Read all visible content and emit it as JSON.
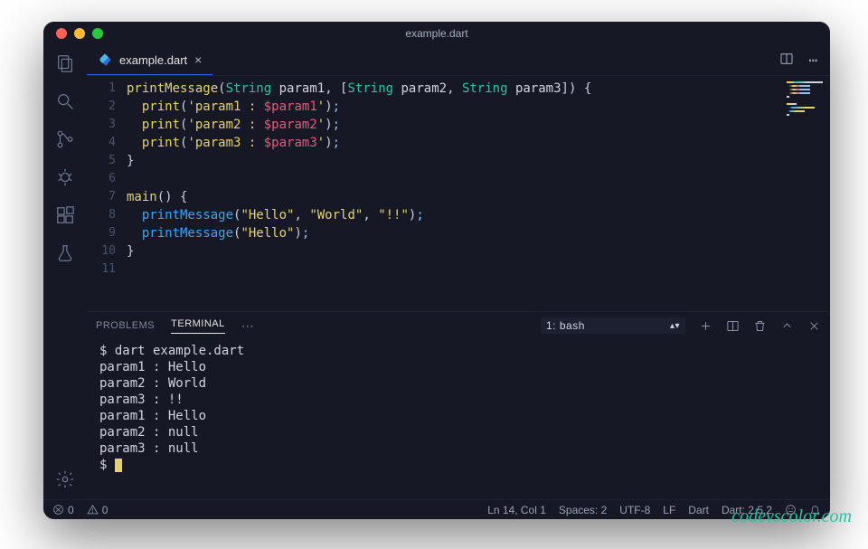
{
  "window": {
    "title": "example.dart"
  },
  "tab": {
    "label": "example.dart"
  },
  "code": {
    "lines": [
      {
        "n": "1",
        "tokens": [
          [
            "fn",
            "printMessage"
          ],
          [
            "paren",
            "("
          ],
          [
            "type",
            "String"
          ],
          [
            "param",
            " param1"
          ],
          [
            "paren",
            ", ["
          ],
          [
            "type",
            "String"
          ],
          [
            "param",
            " param2"
          ],
          [
            "paren",
            ", "
          ],
          [
            "type",
            "String"
          ],
          [
            "param",
            " param3"
          ],
          [
            "paren",
            "]) "
          ],
          [
            "brace",
            "{"
          ]
        ]
      },
      {
        "n": "2",
        "tokens": [
          [
            "plain",
            "  "
          ],
          [
            "fn",
            "print"
          ],
          [
            "paren",
            "("
          ],
          [
            "str",
            "'param1 : "
          ],
          [
            "interp",
            "$param1"
          ],
          [
            "str",
            "'"
          ],
          [
            "paren",
            ")"
          ],
          [
            "punc",
            ";"
          ]
        ]
      },
      {
        "n": "3",
        "tokens": [
          [
            "plain",
            "  "
          ],
          [
            "fn",
            "print"
          ],
          [
            "paren",
            "("
          ],
          [
            "str",
            "'param2 : "
          ],
          [
            "interp",
            "$param2"
          ],
          [
            "str",
            "'"
          ],
          [
            "paren",
            ")"
          ],
          [
            "punc",
            ";"
          ]
        ]
      },
      {
        "n": "4",
        "tokens": [
          [
            "plain",
            "  "
          ],
          [
            "fn",
            "print"
          ],
          [
            "paren",
            "("
          ],
          [
            "str",
            "'param3 : "
          ],
          [
            "interp",
            "$param3"
          ],
          [
            "str",
            "'"
          ],
          [
            "paren",
            ")"
          ],
          [
            "punc",
            ";"
          ]
        ]
      },
      {
        "n": "5",
        "tokens": [
          [
            "brace",
            "}"
          ]
        ]
      },
      {
        "n": "6",
        "tokens": []
      },
      {
        "n": "7",
        "tokens": [
          [
            "fn",
            "main"
          ],
          [
            "paren",
            "() "
          ],
          [
            "brace",
            "{"
          ]
        ]
      },
      {
        "n": "8",
        "tokens": [
          [
            "plain",
            "  "
          ],
          [
            "call",
            "printMessage"
          ],
          [
            "paren",
            "("
          ],
          [
            "str",
            "\"Hello\""
          ],
          [
            "paren",
            ", "
          ],
          [
            "str",
            "\"World\""
          ],
          [
            "paren",
            ", "
          ],
          [
            "str",
            "\"!!\""
          ],
          [
            "paren",
            ")"
          ],
          [
            "punc",
            ";"
          ]
        ]
      },
      {
        "n": "9",
        "tokens": [
          [
            "plain",
            "  "
          ],
          [
            "call",
            "printMessage"
          ],
          [
            "paren",
            "("
          ],
          [
            "str",
            "\"Hello\""
          ],
          [
            "paren",
            ")"
          ],
          [
            "punc",
            ";"
          ]
        ]
      },
      {
        "n": "10",
        "tokens": [
          [
            "brace",
            "}"
          ]
        ]
      },
      {
        "n": "11",
        "tokens": []
      }
    ]
  },
  "panel": {
    "tabs": {
      "problems": "PROBLEMS",
      "terminal": "TERMINAL"
    },
    "shell_label": "1: bash",
    "terminal_lines": [
      "$ dart example.dart",
      "param1 : Hello",
      "param2 : World",
      "param3 : !!",
      "param1 : Hello",
      "param2 : null",
      "param3 : null"
    ],
    "prompt": "$ "
  },
  "status": {
    "errors": "0",
    "warnings": "0",
    "cursor": "Ln 14, Col 1",
    "spaces": "Spaces: 2",
    "encoding": "UTF-8",
    "eol": "LF",
    "language": "Dart",
    "sdk": "Dart: 2.5.2"
  },
  "watermark": "codevscolor.com"
}
